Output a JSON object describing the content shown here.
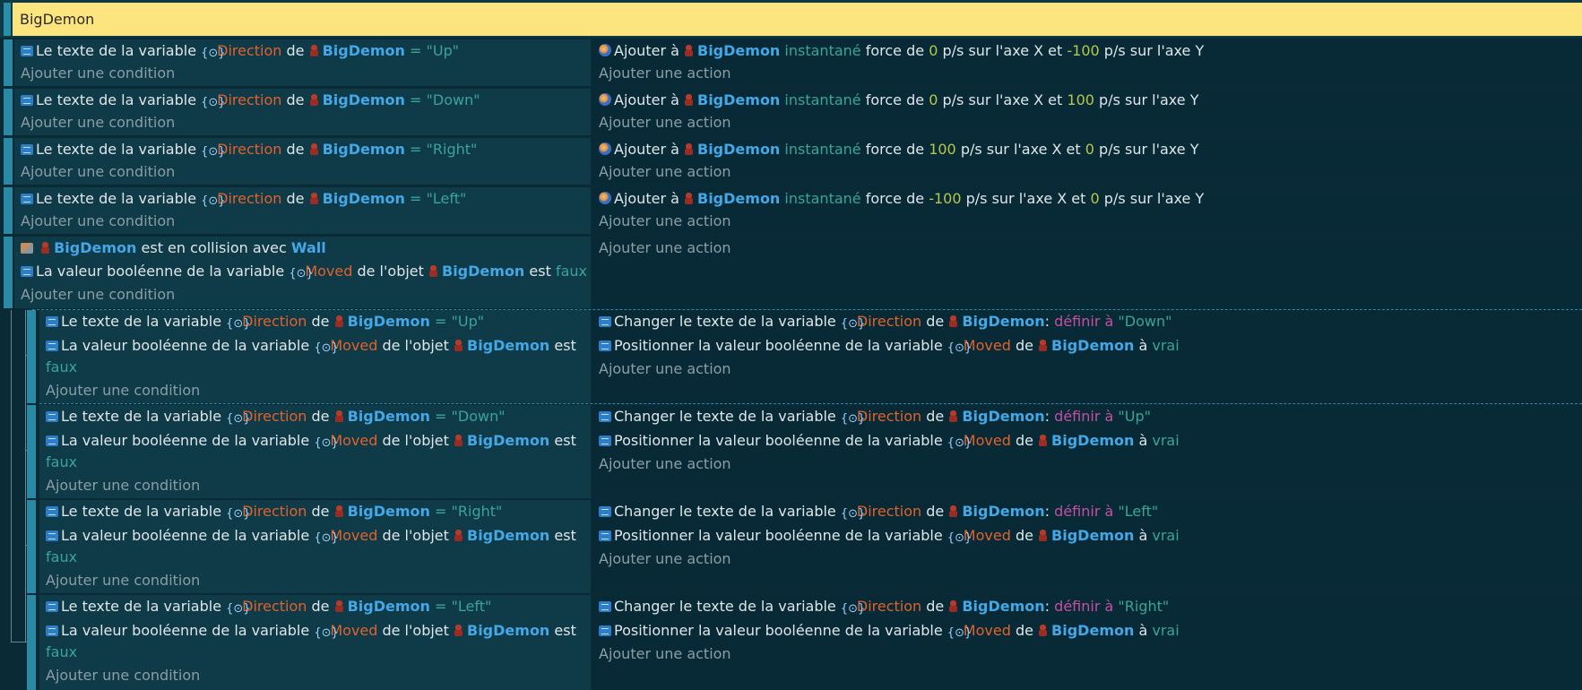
{
  "title": "BigDemon",
  "labels": {
    "var_text": "Le texte de la variable",
    "var_bool": "La valeur booléenne de la variable",
    "de": "de",
    "de_lobjet": "de l'objet",
    "est": "est",
    "faux": "faux",
    "vrai": "vrai",
    "a": "à",
    "add_condition": "Ajouter une condition",
    "add_action": "Ajouter une action",
    "ajouter_a": "Ajouter à",
    "instantane": "instantané",
    "force_de": "force de",
    "ps_axe_x_et": "p/s sur l'axe X et",
    "ps_axe_y": "p/s sur l'axe Y",
    "changer_texte": "Changer le texte de la variable",
    "positionner": "Positionner la valeur booléenne de la variable",
    "definir_a": "définir à",
    "est_en_collision": "est en collision avec",
    "eq": "="
  },
  "objects": {
    "demon": "BigDemon",
    "wall": "Wall"
  },
  "variables": {
    "direction": "Direction",
    "moved": "Moved"
  },
  "events": [
    {
      "cond_value": "\"Up\"",
      "fx": "0",
      "fy": "-100"
    },
    {
      "cond_value": "\"Down\"",
      "fx": "0",
      "fy": "100"
    },
    {
      "cond_value": "\"Right\"",
      "fx": "100",
      "fy": "0"
    },
    {
      "cond_value": "\"Left\"",
      "fx": "-100",
      "fy": "0"
    }
  ],
  "subevents": [
    {
      "cond_value": "\"Up\"",
      "set_value": "\"Down\""
    },
    {
      "cond_value": "\"Down\"",
      "set_value": "\"Up\""
    },
    {
      "cond_value": "\"Right\"",
      "set_value": "\"Left\""
    },
    {
      "cond_value": "\"Left\"",
      "set_value": "\"Right\""
    }
  ],
  "colors": {
    "header": "#fce57e",
    "object": "#44a7e6",
    "variable": "#e0622c",
    "string": "#3aa49b",
    "number": "#b6c84a",
    "operation": "#c64fa2"
  },
  "icons": [
    "variable-icon",
    "variable-brace-icon",
    "demon-object-icon",
    "force-icon",
    "collision-icon"
  ]
}
